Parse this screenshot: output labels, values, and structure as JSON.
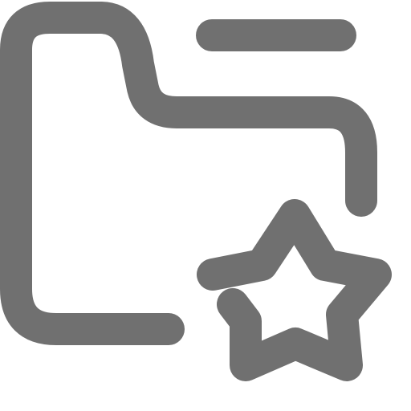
{
  "icon": {
    "name": "folder-star-icon",
    "color": "#707070"
  }
}
